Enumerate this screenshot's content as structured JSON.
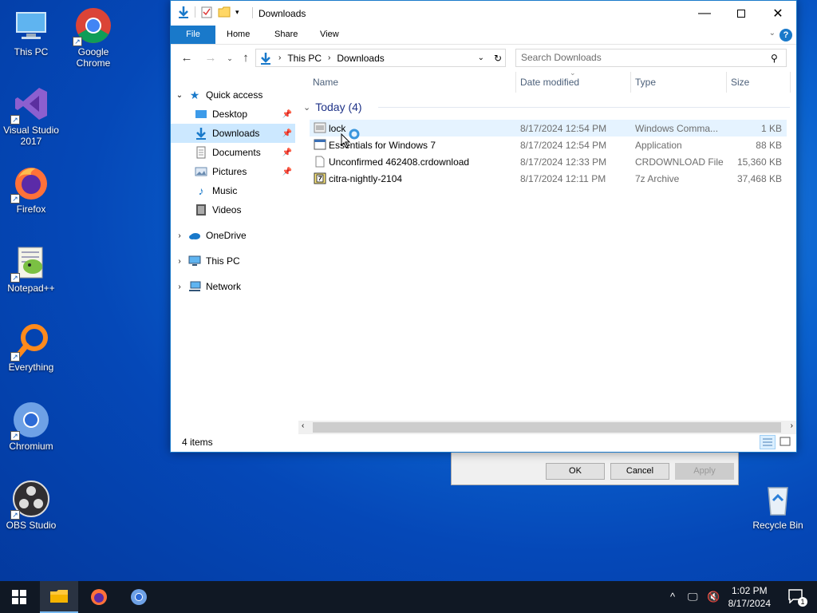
{
  "desktop": {
    "icons": [
      {
        "label": "This PC"
      },
      {
        "label": "Google Chrome"
      },
      {
        "label": "Visual Studio 2017"
      },
      {
        "label": "Firefox"
      },
      {
        "label": "Notepad++"
      },
      {
        "label": "Everything"
      },
      {
        "label": "Chromium"
      },
      {
        "label": "OBS Studio"
      },
      {
        "label": "Recycle Bin"
      }
    ]
  },
  "back_dialog": {
    "ok": "OK",
    "cancel": "Cancel",
    "apply": "Apply"
  },
  "explorer": {
    "title": "Downloads",
    "ribbon_tabs": [
      "File",
      "Home",
      "Share",
      "View"
    ],
    "help": "?",
    "address": {
      "root": "This PC",
      "current": "Downloads"
    },
    "search_placeholder": "Search Downloads",
    "sidebar": {
      "quick_access": "Quick access",
      "items": [
        {
          "label": "Desktop",
          "pinned": true
        },
        {
          "label": "Downloads",
          "pinned": true,
          "selected": true
        },
        {
          "label": "Documents",
          "pinned": true
        },
        {
          "label": "Pictures",
          "pinned": true
        },
        {
          "label": "Music",
          "pinned": false
        },
        {
          "label": "Videos",
          "pinned": false
        }
      ],
      "onedrive": "OneDrive",
      "this_pc": "This PC",
      "network": "Network"
    },
    "columns": {
      "name": "Name",
      "date": "Date modified",
      "type": "Type",
      "size": "Size"
    },
    "group_label": "Today (4)",
    "files": [
      {
        "name": "lock",
        "date": "8/17/2024 12:54 PM",
        "type": "Windows Comma...",
        "size": "1 KB",
        "icon": "batch-file-icon"
      },
      {
        "name": "Essentials for Windows 7",
        "date": "8/17/2024 12:54 PM",
        "type": "Application",
        "size": "88 KB",
        "icon": "application-icon"
      },
      {
        "name": "Unconfirmed 462408.crdownload",
        "date": "8/17/2024 12:33 PM",
        "type": "CRDOWNLOAD File",
        "size": "15,360 KB",
        "icon": "blank-file-icon"
      },
      {
        "name": "citra-nightly-2104",
        "date": "8/17/2024 12:11 PM",
        "type": "7z Archive",
        "size": "37,468 KB",
        "icon": "7z-archive-icon"
      }
    ],
    "status": "4 items"
  },
  "taskbar": {
    "time": "1:02 PM",
    "date": "8/17/2024",
    "notification_count": "1"
  },
  "colors": {
    "accent": "#1979ca",
    "selection": "#cce8ff",
    "taskbar": "#101824"
  }
}
